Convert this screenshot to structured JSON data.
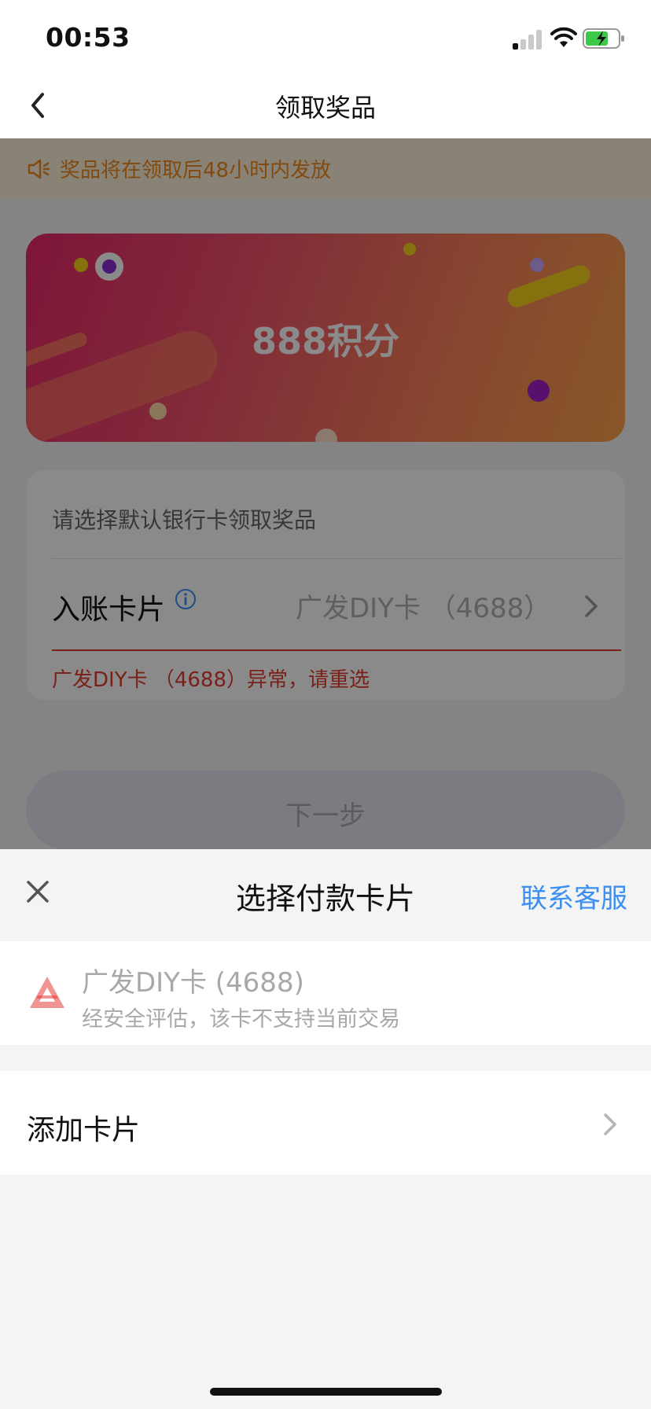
{
  "status_bar": {
    "time": "00:53"
  },
  "nav": {
    "title": "领取奖品"
  },
  "notice": {
    "text": "奖品将在领取后48小时内发放"
  },
  "banner": {
    "label": "888积分"
  },
  "form": {
    "hint": "请选择默认银行卡领取奖品",
    "row_label": "入账卡片",
    "row_value": "广发DIY卡 （4688）",
    "error": "广发DIY卡 （4688）异常，请重选"
  },
  "next_button": {
    "label": "下一步"
  },
  "sheet": {
    "title": "选择付款卡片",
    "link": "联系客服",
    "cards": [
      {
        "name": "广发DIY卡 (4688)",
        "note": "经安全评估，该卡不支持当前交易"
      }
    ],
    "add_label": "添加卡片"
  },
  "colors": {
    "accent_blue": "#3b8ff2",
    "error_red": "#e03c2f",
    "notice_orange": "#f08a1a",
    "bank_logo_red": "#e33a3a"
  },
  "icons": [
    "back-arrow-icon",
    "speaker-icon",
    "info-icon",
    "chevron-right-icon",
    "close-icon",
    "bank-logo-icon"
  ]
}
